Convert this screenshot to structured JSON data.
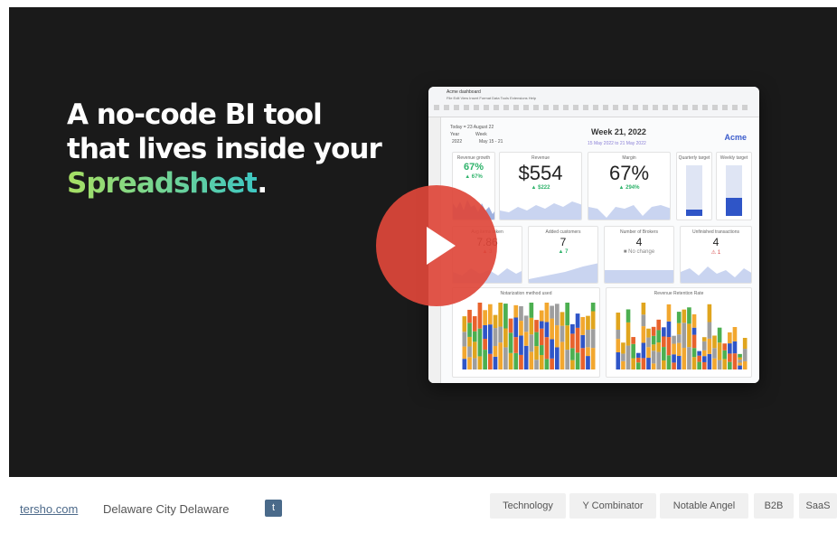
{
  "video": {
    "headline_line1": "A no-code BI tool",
    "headline_line2": "that lives inside your",
    "headline_accent": "Spreadsheet",
    "headline_period": ".",
    "play_icon": "play-icon"
  },
  "dashboard": {
    "title": "Acme dashboard",
    "menu": "File  Edit  View  Insert  Format  Data  Tools  Extensions  Help",
    "filter_label": "Today = 23 August 22",
    "year_label": "Year",
    "week_label": "Week",
    "year_value": "2022",
    "week_value": "May 15 - 21",
    "week_heading": "Week 21, 2022",
    "date_range": "15 May 2022 to 21 May 2022",
    "brand": "Acme",
    "cards": {
      "revenue_growth": {
        "title": "Revenue growth",
        "value": "67%",
        "delta": "▲ 67%"
      },
      "revenue": {
        "title": "Revenue",
        "value": "$554",
        "delta": "▲ $222"
      },
      "margin": {
        "title": "Margin",
        "value": "67%",
        "delta": "▲ 294%"
      },
      "quarterly_target": {
        "title": "Quarterly target",
        "level": 0.12
      },
      "weekly_target": {
        "title": "Weekly target",
        "level": 0.35
      },
      "avg_items": {
        "title": "Avg items taken",
        "value": "7.86",
        "delta": "▲ 3"
      },
      "added_customers": {
        "title": "Added customers",
        "value": "7",
        "delta": "▲ 7"
      },
      "brokers": {
        "title": "Number of Brokers",
        "value": "4",
        "delta": "■ No change"
      },
      "unfinished": {
        "title": "Unfinished transactions",
        "value": "4",
        "delta": "⚠ 1"
      },
      "notarization": {
        "title": "Notarization method used"
      },
      "retention": {
        "title": "Revenue Retention Rate"
      }
    },
    "colors": {
      "accent": "#2f55c7",
      "area": "#c9d4f0",
      "positive": "#2fb36b",
      "negative": "#d64545"
    }
  },
  "footer": {
    "site": "tersho.com",
    "location": "Delaware City Delaware",
    "twitter_icon": "twitter-icon",
    "tags": [
      "Technology",
      "Y Combinator",
      "Notable Angel",
      "B2B",
      "SaaS"
    ]
  }
}
